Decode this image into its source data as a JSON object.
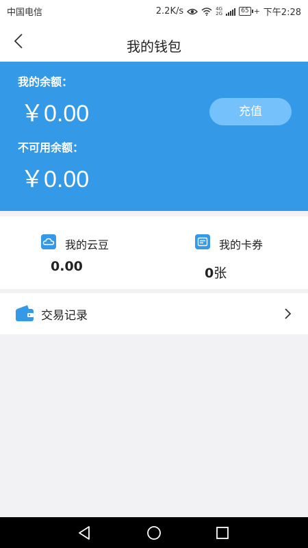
{
  "status_bar": {
    "carrier": "中国电信",
    "speed": "2.2K/s",
    "net_top": "4G",
    "net_bottom": "2G",
    "battery": "65",
    "time": "下午2:28"
  },
  "header": {
    "title": "我的钱包"
  },
  "balance": {
    "label": "我的余额：",
    "amount": "￥0.00",
    "unavailable_label": "不可用余额：",
    "unavailable_amount": "￥0.00",
    "recharge_label": "充值"
  },
  "assets": {
    "yundou": {
      "label": "我的云豆",
      "value": "0.00",
      "icon": "cloud-icon"
    },
    "coupons": {
      "label": "我的卡券",
      "value_number": "0",
      "value_unit": "张",
      "icon": "coupon-icon"
    }
  },
  "transactions": {
    "label": "交易记录",
    "icon": "wallet-icon"
  },
  "colors": {
    "primary": "#3499e6",
    "recharge_button": "#74c1fb",
    "background": "#f2f2f4"
  }
}
